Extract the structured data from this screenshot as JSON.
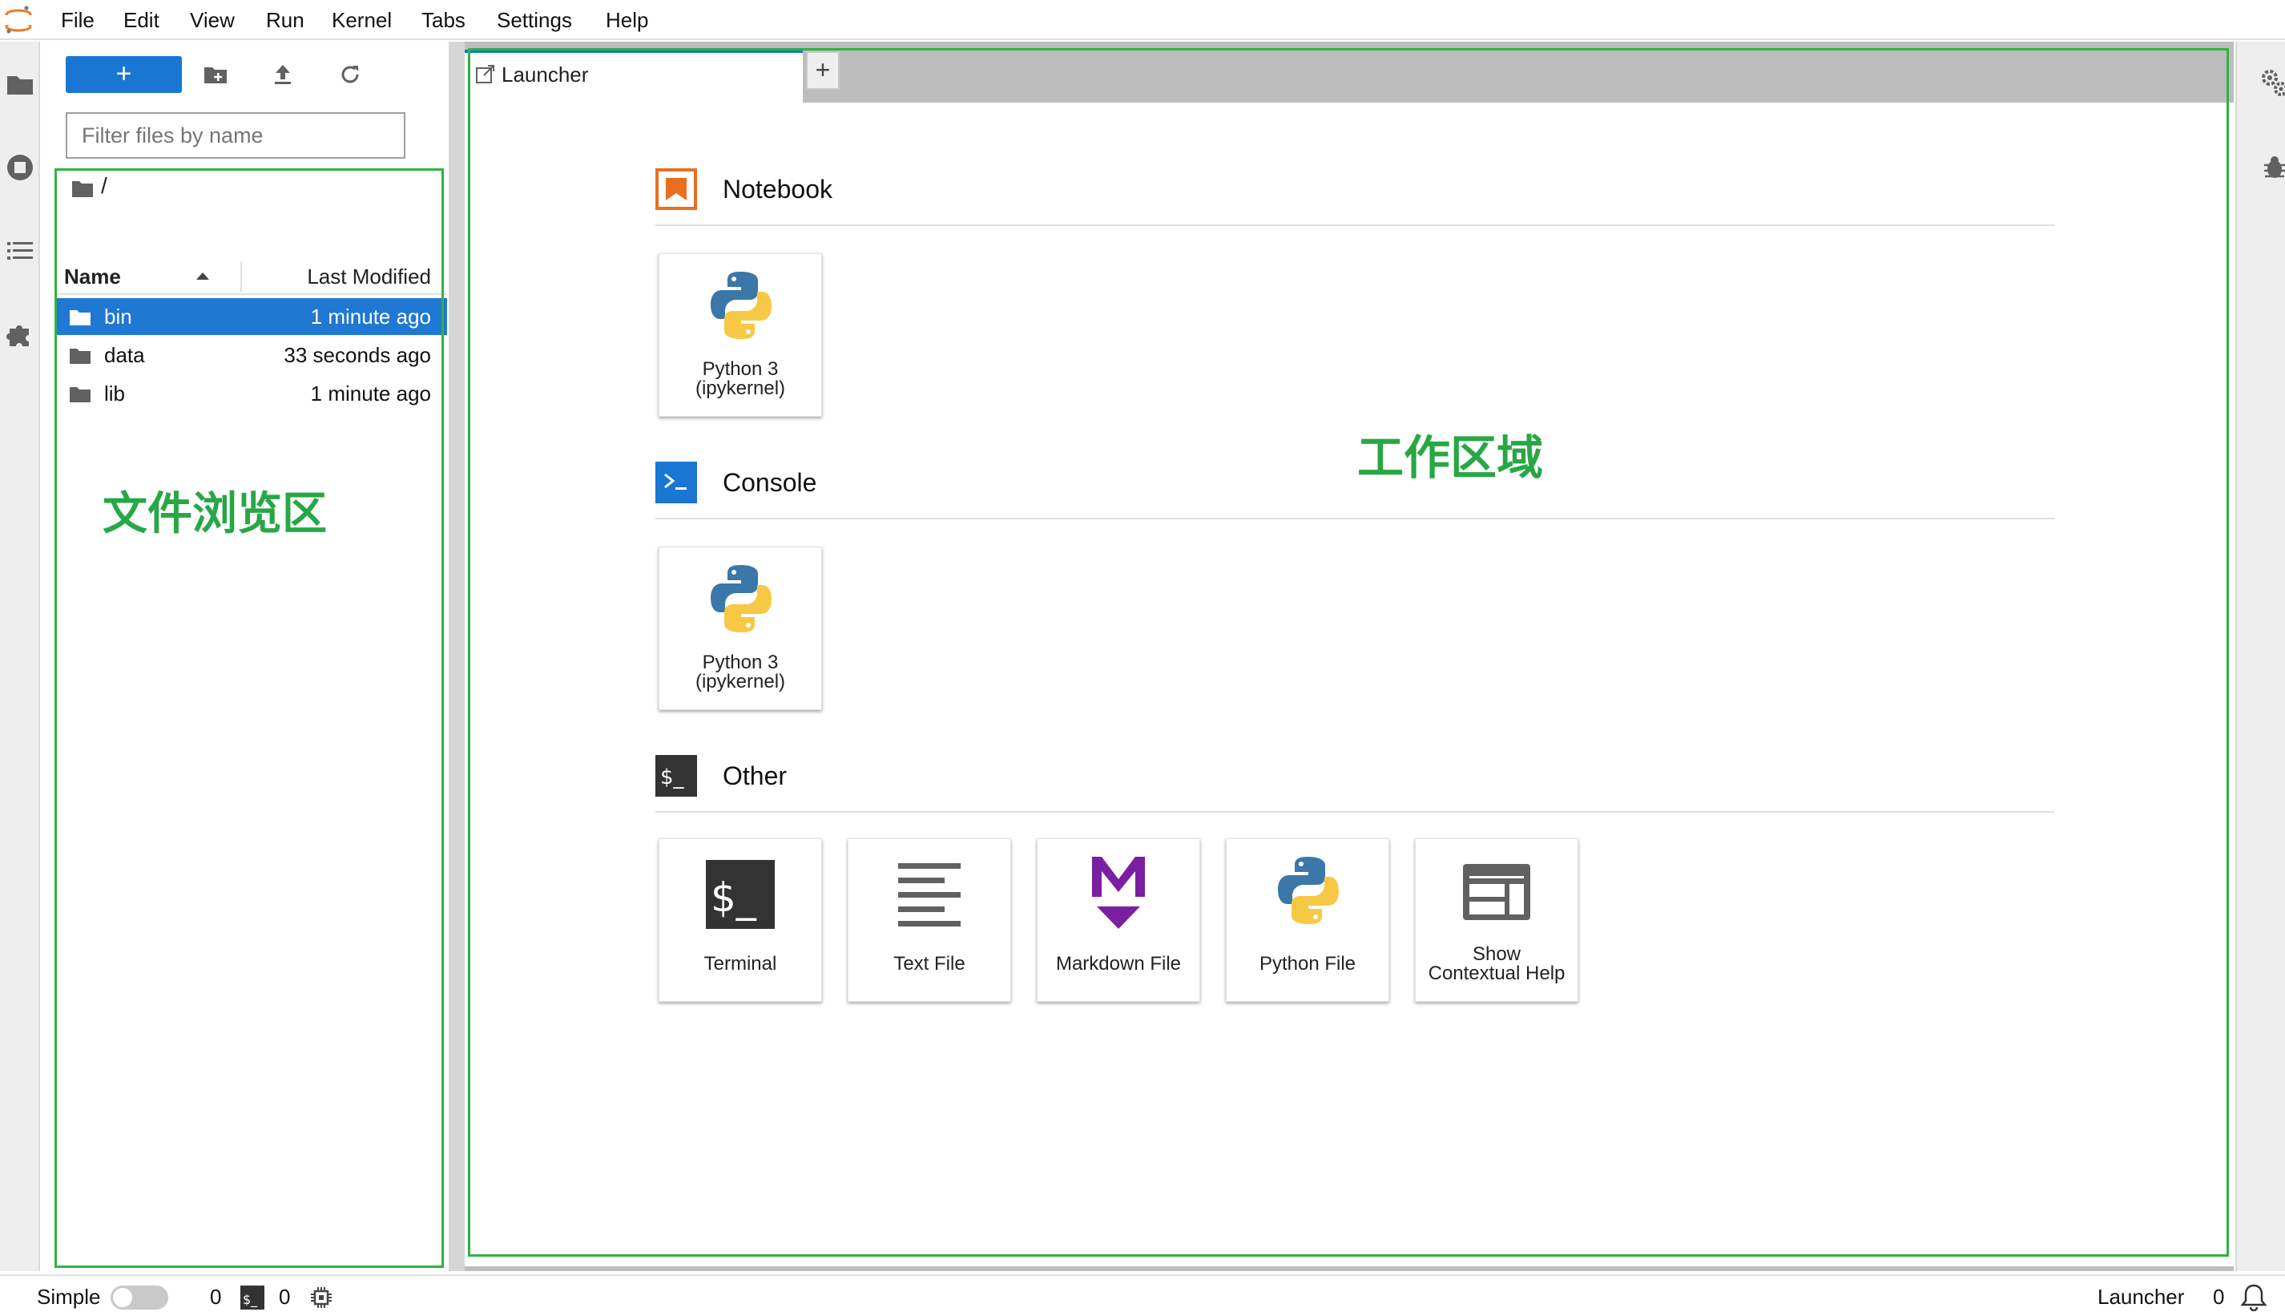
{
  "menubar": {
    "items": [
      "File",
      "Edit",
      "View",
      "Run",
      "Kernel",
      "Tabs",
      "Settings",
      "Help"
    ]
  },
  "filebrowser": {
    "new_label": "+",
    "filter_placeholder": "Filter files by name",
    "breadcrumb": "/",
    "columns": {
      "name": "Name",
      "modified": "Last Modified"
    },
    "files": [
      {
        "name": "bin",
        "modified": "1 minute ago",
        "selected": true
      },
      {
        "name": "data",
        "modified": "33 seconds ago",
        "selected": false
      },
      {
        "name": "lib",
        "modified": "1 minute ago",
        "selected": false
      }
    ],
    "annotation": "文件浏览区"
  },
  "tabs": {
    "active_label": "Launcher",
    "add_label": "+"
  },
  "launcher": {
    "annotation": "工作区域",
    "sections": [
      {
        "title": "Notebook",
        "icon": "notebook-icon",
        "cards": [
          {
            "line1": "Python 3",
            "line2": "(ipykernel)",
            "icon": "python-icon"
          }
        ]
      },
      {
        "title": "Console",
        "icon": "console-icon",
        "cards": [
          {
            "line1": "Python 3",
            "line2": "(ipykernel)",
            "icon": "python-icon"
          }
        ]
      },
      {
        "title": "Other",
        "icon": "terminal-icon",
        "cards": [
          {
            "line1": "Terminal",
            "icon": "terminal-icon"
          },
          {
            "line1": "Text File",
            "icon": "text-file-icon"
          },
          {
            "line1": "Markdown File",
            "icon": "markdown-icon"
          },
          {
            "line1": "Python File",
            "icon": "python-icon"
          },
          {
            "line1": "Show",
            "line2": "Contextual Help",
            "icon": "contextual-help-icon"
          }
        ]
      }
    ]
  },
  "statusbar": {
    "mode_label": "Simple",
    "kernel_count": "0",
    "terminal_count": "0",
    "active_tab": "Launcher",
    "notification_count": "0"
  },
  "colors": {
    "accent": "#1976d2",
    "annotation_green": "#2fb344",
    "notebook_orange": "#e96f1f",
    "markdown_purple": "#7b1fa2"
  }
}
